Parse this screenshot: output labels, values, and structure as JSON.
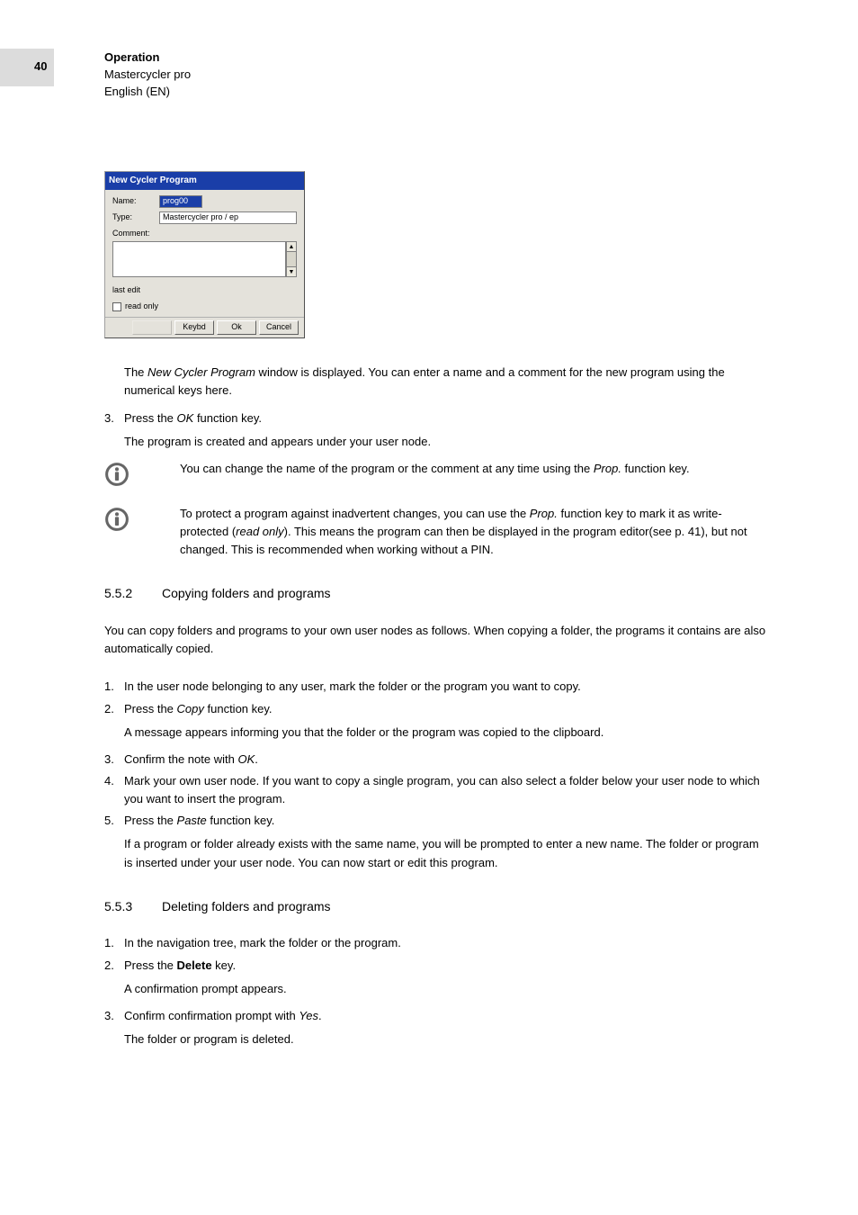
{
  "page_number": "40",
  "header": {
    "line1": "Operation",
    "line2": "Mastercycler pro",
    "line3": "English (EN)"
  },
  "dialog": {
    "title": "New Cycler Program",
    "name_label": "Name:",
    "name_value": "prog00",
    "type_label": "Type:",
    "type_value": "Mastercycler pro / ep",
    "comment_label": "Comment:",
    "lastedit_label": "last edit",
    "readonly_label": "read only",
    "btn_keybd": "Keybd",
    "btn_ok": "Ok",
    "btn_cancel": "Cancel"
  },
  "body": {
    "p1a": "The ",
    "p1b": "New Cycler Program",
    "p1c": " window is displayed. You can enter a name and a comment for the new program using the numerical keys here.",
    "s3_num": "3.",
    "s3a": "Press the ",
    "s3b": "OK",
    "s3c": " function key.",
    "s3_sub": "The program is created and appears under your user node.",
    "info1a": "You can change the name of the program or the comment at any time using the ",
    "info1b": "Prop.",
    "info1c": " function key.",
    "info2a": "To protect a program against inadvertent changes, you can use the ",
    "info2b": "Prop.",
    "info2c": " function key to mark it as write-protected (",
    "info2d": "read only",
    "info2e": "). This means the program can then be displayed in the program editor(see p. 41), but not changed. This is recommended when working without a PIN.",
    "sec552_num": "5.5.2",
    "sec552_title": "Copying folders and programs",
    "sec552_intro": "You can copy folders and programs to your own user nodes as follows. When copying a folder, the programs it contains are also automatically copied.",
    "c1_num": "1.",
    "c1": "In the user node belonging to any user, mark the folder or the program you want to copy.",
    "c2_num": "2.",
    "c2a": "Press the ",
    "c2b": "Copy",
    "c2c": " function key.",
    "c2_sub": "A message appears informing you that the folder or the program was copied to the clipboard.",
    "c3_num": "3.",
    "c3a": "Confirm the note with ",
    "c3b": "OK",
    "c3c": ".",
    "c4_num": "4.",
    "c4": "Mark your own user node. If you want to copy a single program, you can also select a folder below your user node to which you want to insert the program.",
    "c5_num": "5.",
    "c5a": "Press the ",
    "c5b": "Paste",
    "c5c": " function key.",
    "c5_sub": "If a program or folder already exists with the same name, you will be prompted to enter a new name. The folder or program is inserted under your user node. You can now start or edit this program.",
    "sec553_num": "5.5.3",
    "sec553_title": "Deleting folders and programs",
    "d1_num": "1.",
    "d1": "In the navigation tree, mark the folder or the program.",
    "d2_num": "2.",
    "d2a": "Press the ",
    "d2b": "Delete",
    "d2c": " key.",
    "d2_sub": "A confirmation prompt appears.",
    "d3_num": "3.",
    "d3a": "Confirm confirmation prompt with ",
    "d3b": "Yes",
    "d3c": ".",
    "d3_sub": "The folder or program is deleted."
  }
}
